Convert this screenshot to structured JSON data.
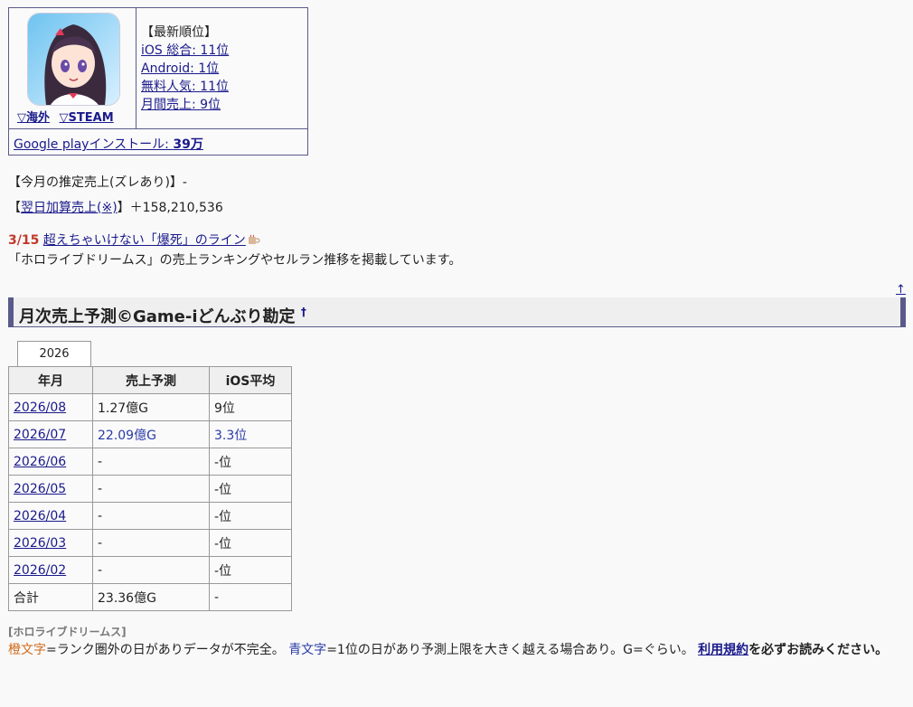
{
  "icon_links": {
    "overseas": "▽海外",
    "steam": "▽STEAM"
  },
  "rank": {
    "heading": "【最新順位】",
    "items": [
      "iOS 総合: 11位",
      "Android: 1位",
      "無料人気: 11位",
      "月間売上: 9位"
    ]
  },
  "install": {
    "label": "Google playインストール: ",
    "value": "39万"
  },
  "sales": {
    "estimate_label": "【今月の推定売上(ズレあり)】-",
    "next_day_prefix": "【",
    "next_day_link": "翌日加算売上(※)",
    "next_day_suffix": "】＋158,210,536"
  },
  "news": {
    "date": "3/15",
    "link": "超えちゃいけない「爆死」のライン",
    "description": "「ホロライブドリームス」の売上ランキングやセルラン推移を掲載しています。"
  },
  "up_arrow": "↑",
  "section": {
    "title": "月次売上予測©Game-iどんぶり勘定",
    "sup": "†"
  },
  "year_tab": "2026",
  "table": {
    "headers": [
      "年月",
      "売上予測",
      "iOS平均"
    ],
    "rows": [
      {
        "month": "2026/08",
        "sales": "1.27億G",
        "ios": "9位"
      },
      {
        "month": "2026/07",
        "sales": "22.09億G",
        "ios": "3.3位"
      },
      {
        "month": "2026/06",
        "sales": "-",
        "ios": "-位"
      },
      {
        "month": "2026/05",
        "sales": "-",
        "ios": "-位"
      },
      {
        "month": "2026/04",
        "sales": "-",
        "ios": "-位"
      },
      {
        "month": "2026/03",
        "sales": "-",
        "ios": "-位"
      },
      {
        "month": "2026/02",
        "sales": "-",
        "ios": "-位"
      }
    ],
    "total": {
      "label": "合計",
      "sales": "23.36億G",
      "ios": "-"
    }
  },
  "legend": {
    "title": "[ホロライブドリームス]",
    "orange_word": "橙文字",
    "orange_text": "=ランク圏外の日がありデータが不完全。",
    "blue_word": "青文字",
    "blue_text": "=1位の日があり予測上限を大きく越える場合あり。G=ぐらい。",
    "terms_link": "利用規約",
    "terms_text": "を必ずお読みください。"
  },
  "colors": {
    "accent": "#5a5a8a",
    "link": "#1a1a8c",
    "orange": "#d06a1a",
    "blue": "#2a3aa8",
    "date_red": "#c0392b"
  }
}
